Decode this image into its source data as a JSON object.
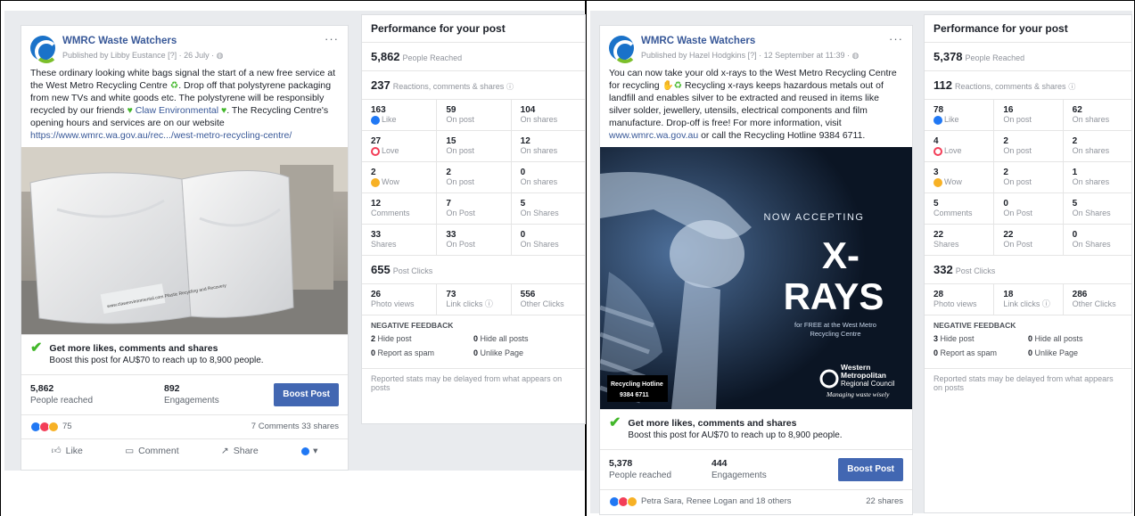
{
  "left": {
    "post": {
      "page_name": "WMRC Waste Watchers",
      "published": "Published by Libby Eustance [?] · 26 July · ",
      "menu": "···",
      "text1": "These ordinary looking white bags signal the start of a new free service at the West Metro Recycling Centre ",
      "text2": ". Drop off that polystyrene packaging from new TVs and white goods etc. The polystyrene will be responsibly recycled by our friends ",
      "tag": "Claw Environmental",
      "text3": ". The Recycling Centre's opening hours and services are on our website ",
      "link": "https://www.wmrc.wa.gov.au/rec.../west-metro-recycling-centre/",
      "bag_print": "www.clawenvironmental.com Plastic Recycling and Recovery",
      "boost_title": "Get more likes, comments and shares",
      "boost_sub": "Boost this post for AU$70 to reach up to 8,900 people.",
      "reached_n": "5,862",
      "reached_l": "People reached",
      "eng_n": "892",
      "eng_l": "Engagements",
      "boost_btn": "Boost Post",
      "react_count": "75",
      "comments_shares": "7 Comments  33 shares",
      "like": "Like",
      "comment": "Comment",
      "share": "Share"
    },
    "perf": {
      "title": "Performance for your post",
      "reach_n": "5,862",
      "reach_l": "People Reached",
      "rcs_n": "237",
      "rcs_l": "Reactions, comments & shares",
      "rows": [
        {
          "a_n": "163",
          "a_l": "Like",
          "b_n": "59",
          "b_l": "On post",
          "c_n": "104",
          "c_l": "On shares",
          "icon": "like"
        },
        {
          "a_n": "27",
          "a_l": "Love",
          "b_n": "15",
          "b_l": "On post",
          "c_n": "12",
          "c_l": "On shares",
          "icon": "love"
        },
        {
          "a_n": "2",
          "a_l": "Wow",
          "b_n": "2",
          "b_l": "On post",
          "c_n": "0",
          "c_l": "On shares",
          "icon": "wow"
        },
        {
          "a_n": "12",
          "a_l": "Comments",
          "b_n": "7",
          "b_l": "On Post",
          "c_n": "5",
          "c_l": "On Shares",
          "icon": ""
        },
        {
          "a_n": "33",
          "a_l": "Shares",
          "b_n": "33",
          "b_l": "On Post",
          "c_n": "0",
          "c_l": "On Shares",
          "icon": ""
        }
      ],
      "clicks_n": "655",
      "clicks_l": "Post Clicks",
      "clicks": {
        "a_n": "26",
        "a_l": "Photo views",
        "b_n": "73",
        "b_l": "Link clicks",
        "c_n": "556",
        "c_l": "Other Clicks"
      },
      "neg_title": "NEGATIVE FEEDBACK",
      "neg": {
        "hide_n": "2",
        "hide_l": "Hide post",
        "hideall_n": "0",
        "hideall_l": "Hide all posts",
        "spam_n": "0",
        "spam_l": "Report as spam",
        "unlike_n": "0",
        "unlike_l": "Unlike Page"
      },
      "footer": "Reported stats may be delayed from what appears on posts"
    }
  },
  "right": {
    "post": {
      "page_name": "WMRC Waste Watchers",
      "published": "Published by Hazel Hodgkins [?] · 12 September at 11:39 · ",
      "menu": "···",
      "text1": "You can now take your old x-rays to the West Metro Recycling Centre for recycling ",
      "text2": " Recycling x-rays keeps hazardous metals out of landfill and enables silver to be extracted and reused in items like silver solder, jewellery, utensils, electrical components and film manufacture. Drop-off is free! For more information, visit ",
      "link": "www.wmrc.wa.gov.au",
      "text3": " or call the Recycling Hotline 9384 6711.",
      "img_now": "NOW ACCEPTING",
      "img_x": "X-",
      "img_rays": "RAYS",
      "img_free1": "for FREE at the West Metro",
      "img_free2": "Recycling Centre",
      "img_hotline1": "Recycling Hotline",
      "img_hotline2": "9384 6711",
      "img_logo1": "Western",
      "img_logo2": "Metropolitan",
      "img_logo3": "Regional Council",
      "img_logo4": "Managing waste wisely",
      "boost_title": "Get more likes, comments and shares",
      "boost_sub": "Boost this post for AU$70 to reach up to 8,900 people.",
      "reached_n": "5,378",
      "reached_l": "People reached",
      "eng_n": "444",
      "eng_l": "Engagements",
      "boost_btn": "Boost Post",
      "react_names": "Petra Sara, Renee Logan and 18 others",
      "shares": "22 shares"
    },
    "perf": {
      "title": "Performance for your post",
      "reach_n": "5,378",
      "reach_l": "People Reached",
      "rcs_n": "112",
      "rcs_l": "Reactions, comments & shares",
      "rows": [
        {
          "a_n": "78",
          "a_l": "Like",
          "b_n": "16",
          "b_l": "On post",
          "c_n": "62",
          "c_l": "On shares",
          "icon": "like"
        },
        {
          "a_n": "4",
          "a_l": "Love",
          "b_n": "2",
          "b_l": "On post",
          "c_n": "2",
          "c_l": "On shares",
          "icon": "love"
        },
        {
          "a_n": "3",
          "a_l": "Wow",
          "b_n": "2",
          "b_l": "On post",
          "c_n": "1",
          "c_l": "On shares",
          "icon": "wow"
        },
        {
          "a_n": "5",
          "a_l": "Comments",
          "b_n": "0",
          "b_l": "On Post",
          "c_n": "5",
          "c_l": "On Shares",
          "icon": ""
        },
        {
          "a_n": "22",
          "a_l": "Shares",
          "b_n": "22",
          "b_l": "On Post",
          "c_n": "0",
          "c_l": "On Shares",
          "icon": ""
        }
      ],
      "clicks_n": "332",
      "clicks_l": "Post Clicks",
      "clicks": {
        "a_n": "28",
        "a_l": "Photo views",
        "b_n": "18",
        "b_l": "Link clicks",
        "c_n": "286",
        "c_l": "Other Clicks"
      },
      "neg_title": "NEGATIVE FEEDBACK",
      "neg": {
        "hide_n": "3",
        "hide_l": "Hide post",
        "hideall_n": "0",
        "hideall_l": "Hide all posts",
        "spam_n": "0",
        "spam_l": "Report as spam",
        "unlike_n": "0",
        "unlike_l": "Unlike Page"
      },
      "footer": "Reported stats may be delayed from what appears on posts"
    }
  }
}
